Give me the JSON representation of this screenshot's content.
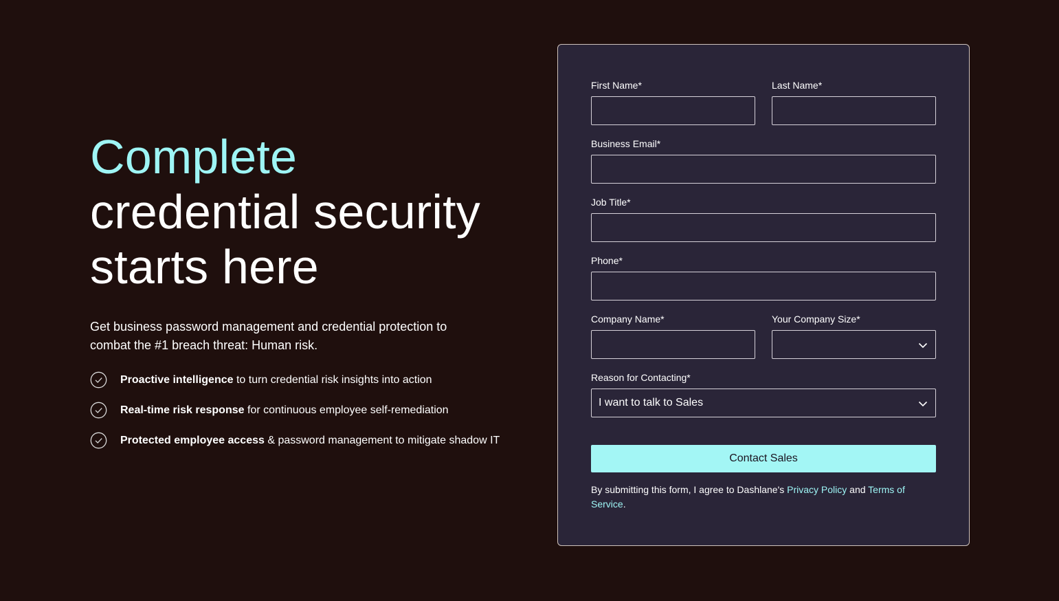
{
  "hero": {
    "headline_accent": "Complete",
    "headline_line2": "credential security",
    "headline_line3": "starts here",
    "subtitle": "Get business password management and credential protection to combat the #1 breach threat: Human risk.",
    "features": [
      {
        "bold": "Proactive intelligence",
        "rest": " to turn credential risk insights into action",
        "icon": "check-circle-icon"
      },
      {
        "bold": "Real-time risk response",
        "rest": " for continuous employee self-remediation",
        "icon": "check-circle-icon"
      },
      {
        "bold": "Protected employee access",
        "rest": " & password management to mitigate shadow IT",
        "icon": "check-circle-icon"
      }
    ]
  },
  "form": {
    "first_name": {
      "label": "First Name*",
      "value": ""
    },
    "last_name": {
      "label": "Last Name*",
      "value": ""
    },
    "email": {
      "label": "Business Email*",
      "value": ""
    },
    "job_title": {
      "label": "Job Title*",
      "value": ""
    },
    "phone": {
      "label": "Phone*",
      "value": ""
    },
    "company_name": {
      "label": "Company Name*",
      "value": ""
    },
    "company_size": {
      "label": "Your Company Size*",
      "selected": ""
    },
    "reason": {
      "label": "Reason for Contacting*",
      "selected": "I want to talk to Sales"
    },
    "submit_label": "Contact Sales",
    "legal": {
      "prefix": "By submitting this form, I agree to Dashlane's ",
      "privacy_link": "Privacy Policy",
      "middle": " and ",
      "terms_link": "Terms of Service",
      "suffix": "."
    }
  },
  "colors": {
    "background": "#1f0f0d",
    "card": "#2a2538",
    "accent": "#9ef5f5",
    "button": "#a3f6f5"
  }
}
